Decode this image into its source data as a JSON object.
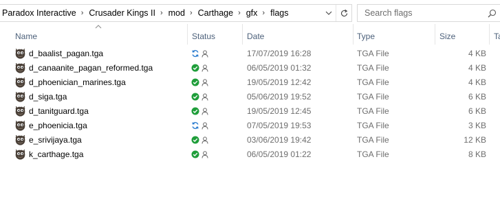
{
  "address_bar": {
    "crumbs": [
      "Paradox Interactive",
      "Crusader Kings II",
      "mod",
      "Carthage",
      "gfx",
      "flags"
    ],
    "separator": "›",
    "dropdown_icon": "chevron-down-icon",
    "refresh_icon": "refresh-icon"
  },
  "search": {
    "placeholder": "Search flags",
    "icon": "search-icon"
  },
  "columns": {
    "name": "Name",
    "status": "Status",
    "date": "Date",
    "type": "Type",
    "size": "Size",
    "tags": "Ta",
    "sorted_by": "name",
    "sort_direction": "ascending"
  },
  "files": [
    {
      "name": "d_baalist_pagan.tga",
      "status": "sync",
      "date": "17/07/2019 16:28",
      "type": "TGA File",
      "size": "4 KB"
    },
    {
      "name": "d_canaanite_pagan_reformed.tga",
      "status": "available",
      "date": "06/05/2019 01:32",
      "type": "TGA File",
      "size": "4 KB"
    },
    {
      "name": "d_phoenician_marines.tga",
      "status": "available",
      "date": "19/05/2019 12:42",
      "type": "TGA File",
      "size": "4 KB"
    },
    {
      "name": "d_siga.tga",
      "status": "available",
      "date": "05/06/2019 19:52",
      "type": "TGA File",
      "size": "6 KB"
    },
    {
      "name": "d_tanitguard.tga",
      "status": "available",
      "date": "19/05/2019 12:45",
      "type": "TGA File",
      "size": "6 KB"
    },
    {
      "name": "e_phoenicia.tga",
      "status": "sync",
      "date": "07/05/2019 19:53",
      "type": "TGA File",
      "size": "3 KB"
    },
    {
      "name": "e_srivijaya.tga",
      "status": "available",
      "date": "03/06/2019 19:42",
      "type": "TGA File",
      "size": "12 KB"
    },
    {
      "name": "k_carthage.tga",
      "status": "available",
      "date": "06/05/2019 01:22",
      "type": "TGA File",
      "size": "8 KB"
    }
  ],
  "colors": {
    "header_text": "#4c607a",
    "secondary_text": "#6d6d6d",
    "status_available": "#1f9e3a",
    "status_sync": "#2f7fd0",
    "divider": "#e5e5e5"
  },
  "icons": {
    "file": "gimp-tga-file-icon",
    "status_available": "check-circle-icon",
    "status_sync": "sync-arrows-icon",
    "shared": "person-icon"
  }
}
